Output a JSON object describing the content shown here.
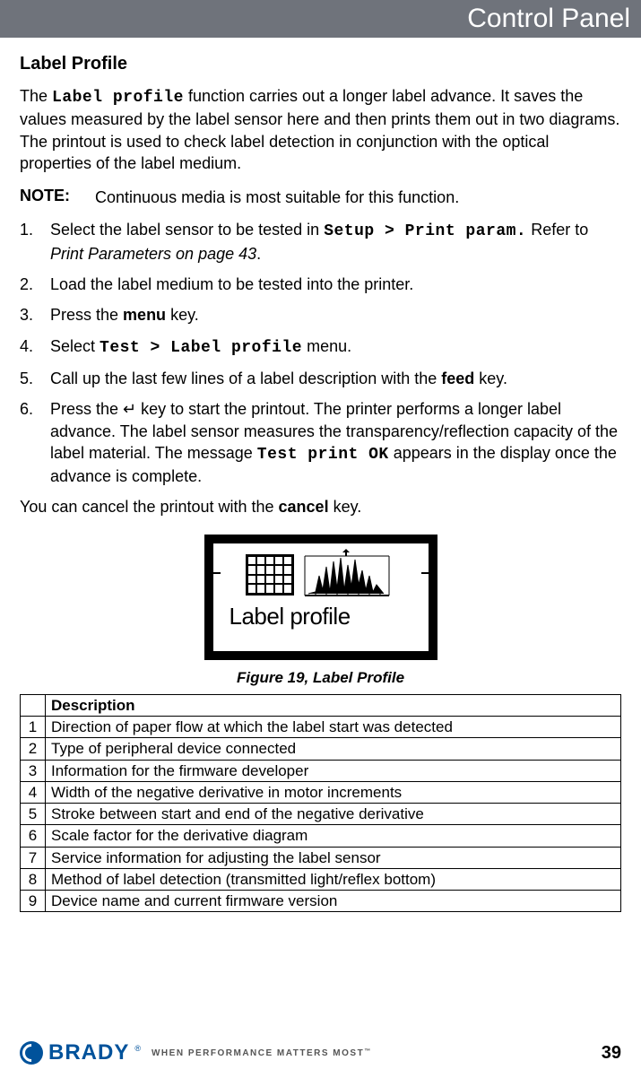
{
  "header": {
    "title": "Control Panel"
  },
  "section": {
    "heading": "Label Profile",
    "intro_pre": "The ",
    "intro_mono": "Label profile",
    "intro_post": " function carries out a longer label advance. It saves the values measured by the label sensor here and then prints them out in two diagrams. The printout is used to check label detection in conjunction with the optical properties of the label medium.",
    "note_label": "NOTE:",
    "note_text": "Continuous media is most suitable for this function.",
    "steps": {
      "s1_a": "Select the label sensor to be tested in ",
      "s1_mono": "Setup > Print param.",
      "s1_b": " Refer to ",
      "s1_italic": "Print Parameters on page 43",
      "s1_c": ".",
      "s2": "Load the label medium to be tested into the printer.",
      "s3_a": "Press the ",
      "s3_bold": "menu",
      "s3_b": " key.",
      "s4_a": "Select ",
      "s4_mono": "Test > Label profile",
      "s4_b": " menu.",
      "s5_a": "Call up the last few lines of a label description with the ",
      "s5_bold": "feed",
      "s5_b": " key.",
      "s6_a": "Press the ",
      "s6_sym": "↵",
      "s6_b": " key to start the printout. The printer performs a longer label advance. The label sensor measures the transparency/reflection capacity of the label material. The message ",
      "s6_mono": "Test print OK",
      "s6_c": " appears in the display once the advance is complete."
    },
    "cancel_a": "You can cancel the printout with the ",
    "cancel_bold": "cancel",
    "cancel_b": " key."
  },
  "figure": {
    "screen_label": "Label profile",
    "caption": "Figure 19, Label Profile"
  },
  "table": {
    "header": "Description",
    "rows": [
      {
        "n": "1",
        "d": "Direction of paper flow at which the label start was detected"
      },
      {
        "n": "2",
        "d": "Type of peripheral device connected"
      },
      {
        "n": "3",
        "d": "Information for the firmware developer"
      },
      {
        "n": "4",
        "d": "Width of the negative derivative in motor increments"
      },
      {
        "n": "5",
        "d": "Stroke between start and end of the negative derivative"
      },
      {
        "n": "6",
        "d": "Scale factor for the derivative diagram"
      },
      {
        "n": "7",
        "d": "Service information for adjusting the label sensor"
      },
      {
        "n": "8",
        "d": "Method of label detection (transmitted light/reflex bottom)"
      },
      {
        "n": "9",
        "d": "Device name and current firmware version"
      }
    ]
  },
  "footer": {
    "brand": "BRADY",
    "reg": "®",
    "tagline": "WHEN PERFORMANCE MATTERS MOST",
    "tm": "™",
    "page": "39"
  }
}
